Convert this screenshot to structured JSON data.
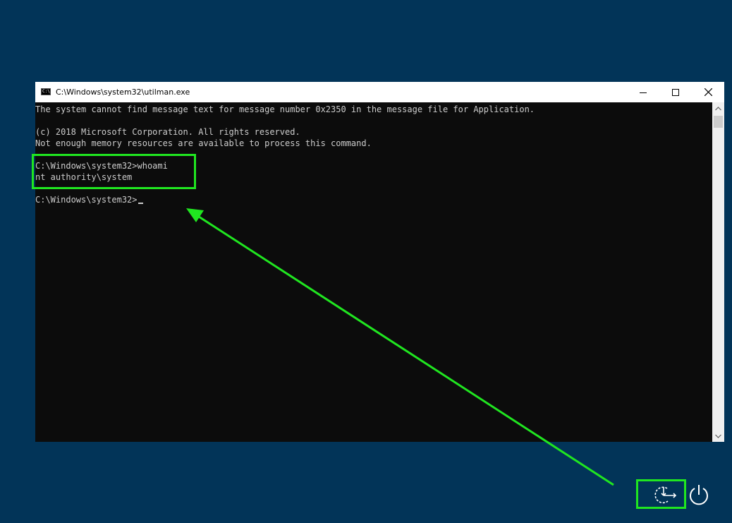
{
  "window": {
    "title": "C:\\Windows\\system32\\utilman.exe",
    "icon": "cmd-icon",
    "icon_label": "C:\\"
  },
  "console": {
    "lines": [
      "The system cannot find message text for message number 0x2350 in the message file for Application.",
      "",
      "(c) 2018 Microsoft Corporation. All rights reserved.",
      "Not enough memory resources are available to process this command.",
      "",
      "C:\\Windows\\system32>whoami",
      "nt authority\\system",
      "",
      "C:\\Windows\\system32>"
    ]
  },
  "taskbar_icons": [
    "ease-of-access-icon",
    "power-icon"
  ],
  "colors": {
    "desktop_bg": "#023458",
    "console_bg": "#0c0c0c",
    "console_text": "#cccccc",
    "highlight": "#20e620"
  }
}
